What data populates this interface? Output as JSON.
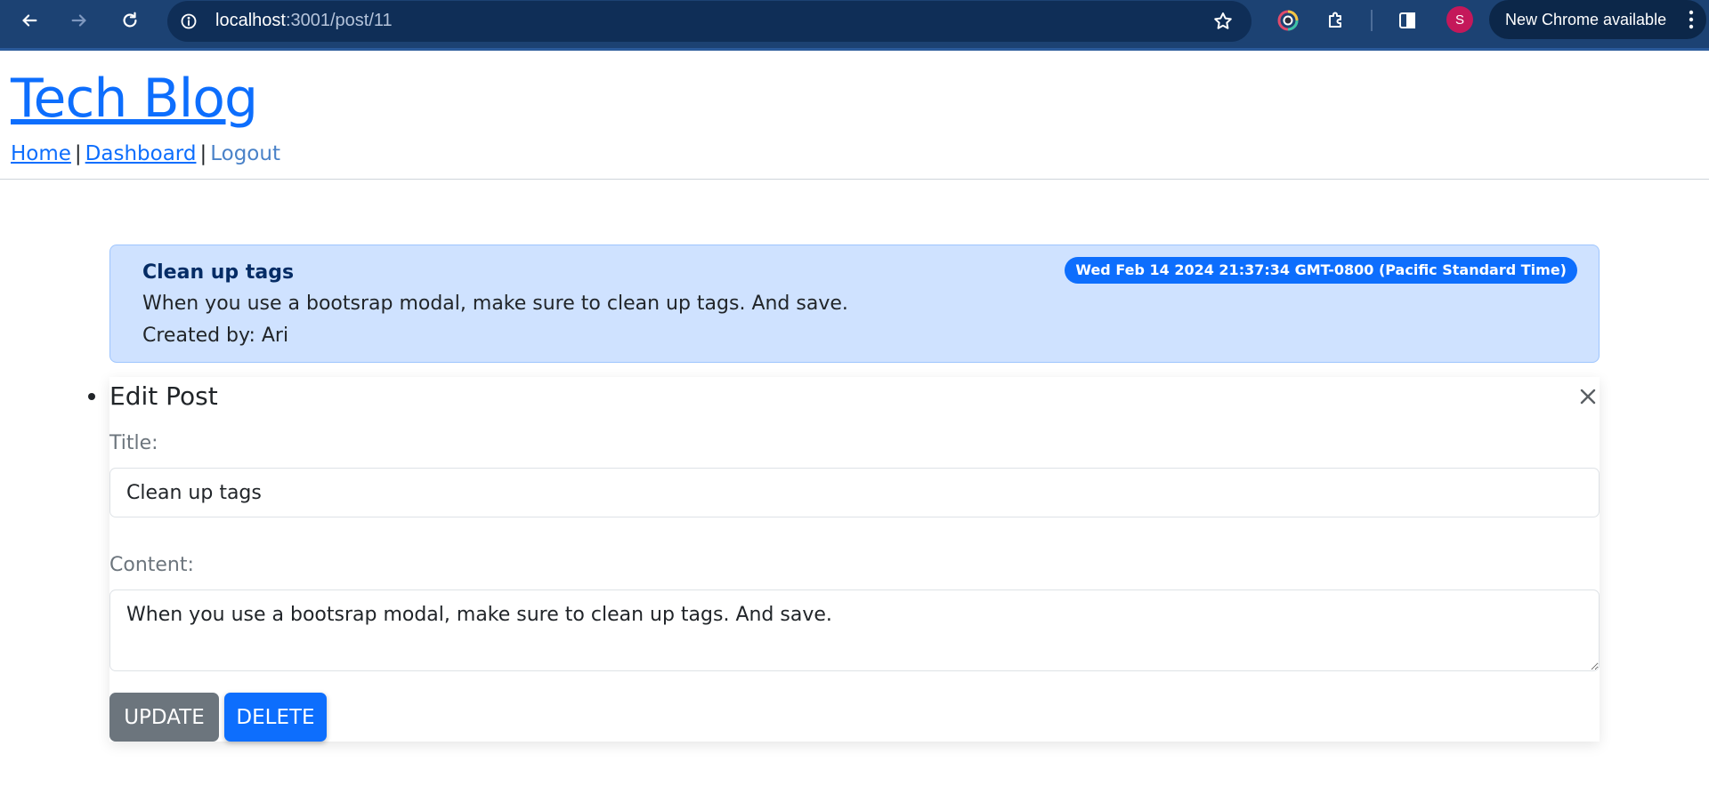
{
  "browser": {
    "url_host": "localhost",
    "url_rest": ":3001/post/11",
    "update_chip": "New Chrome available",
    "avatar_initial": "S"
  },
  "site": {
    "title": "Tech Blog",
    "nav": {
      "home": "Home",
      "dashboard": "Dashboard",
      "logout": "Logout",
      "separator": "|"
    }
  },
  "post": {
    "title": "Clean up tags",
    "content": "When you use a bootsrap modal, make sure to clean up tags. And save.",
    "author_line": "Created by: Ari",
    "date": "Wed Feb 14 2024 21:37:34 GMT-0800 (Pacific Standard Time)"
  },
  "edit_form": {
    "heading": "Edit Post",
    "title_label": "Title:",
    "title_value": "Clean up tags",
    "content_label": "Content:",
    "content_value": "When you use a bootsrap modal, make sure to clean up tags. And save.",
    "update_label": "UPDATE",
    "delete_label": "DELETE"
  },
  "colors": {
    "primary": "#0d6efd",
    "secondary": "#6c757d",
    "card_bg": "#cfe2ff",
    "chrome_bg": "#1c4273"
  },
  "icons": [
    "back-icon",
    "forward-icon",
    "reload-icon",
    "info-icon",
    "star-icon",
    "color-extension-icon",
    "puzzle-icon",
    "side-panel-icon",
    "more-vert-icon",
    "close-icon"
  ]
}
